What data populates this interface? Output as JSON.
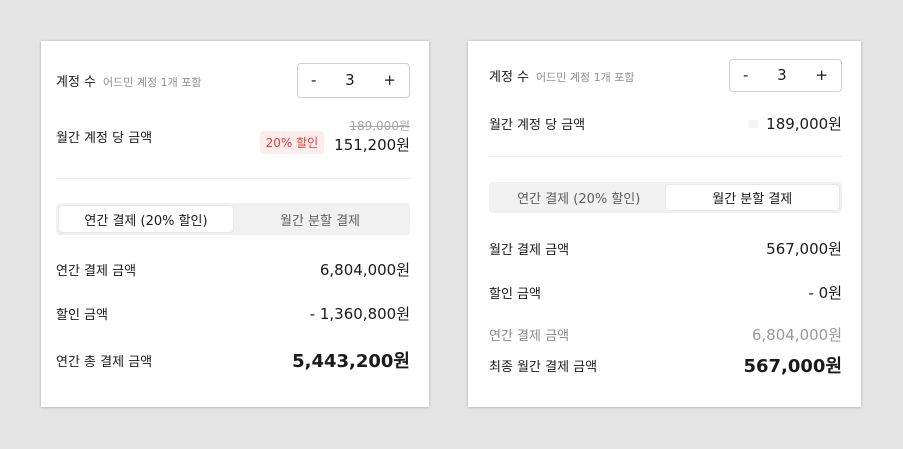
{
  "left": {
    "accounts": {
      "label": "계정 수",
      "sub": "어드민 계정 1개 포함",
      "minus": "-",
      "count": "3",
      "plus": "+"
    },
    "monthly_per_account": {
      "label": "월간 계정 당 금액",
      "original_price": "189,000원",
      "discount_badge": "20% 할인",
      "price": "151,200원"
    },
    "tabs": [
      {
        "label": "연간 결제 (20% 할인)",
        "active": true
      },
      {
        "label": "월간 분할 결제",
        "active": false
      }
    ],
    "annual_total": {
      "label": "연간 결제 금액",
      "value": "6,804,000원"
    },
    "discount": {
      "label": "할인 금액",
      "value": "- 1,360,800원"
    },
    "annual_final": {
      "label": "연간 총 결제 금액",
      "value": "5,443,200원"
    }
  },
  "right": {
    "accounts": {
      "label": "계정 수",
      "sub": "어드민 계정 1개 포함",
      "minus": "-",
      "count": "3",
      "plus": "+"
    },
    "monthly_per_account": {
      "label": "월간 계정 당 금액",
      "price": "189,000원"
    },
    "tabs": [
      {
        "label": "연간 결제 (20% 할인)",
        "active": false
      },
      {
        "label": "월간 분할 결제",
        "active": true
      }
    ],
    "monthly_total": {
      "label": "월간 결제 금액",
      "value": "567,000원"
    },
    "discount": {
      "label": "할인 금액",
      "value": "- 0원"
    },
    "annual_total": {
      "label": "연간 결제 금액",
      "value": "6,804,000원"
    },
    "monthly_final": {
      "label": "최종 월간 결제 금액",
      "value": "567,000원"
    }
  },
  "colors": {
    "background": "#e4e4e4",
    "panel": "#ffffff",
    "discount_red": "#e23b3b",
    "discount_bg": "#fdecec"
  }
}
